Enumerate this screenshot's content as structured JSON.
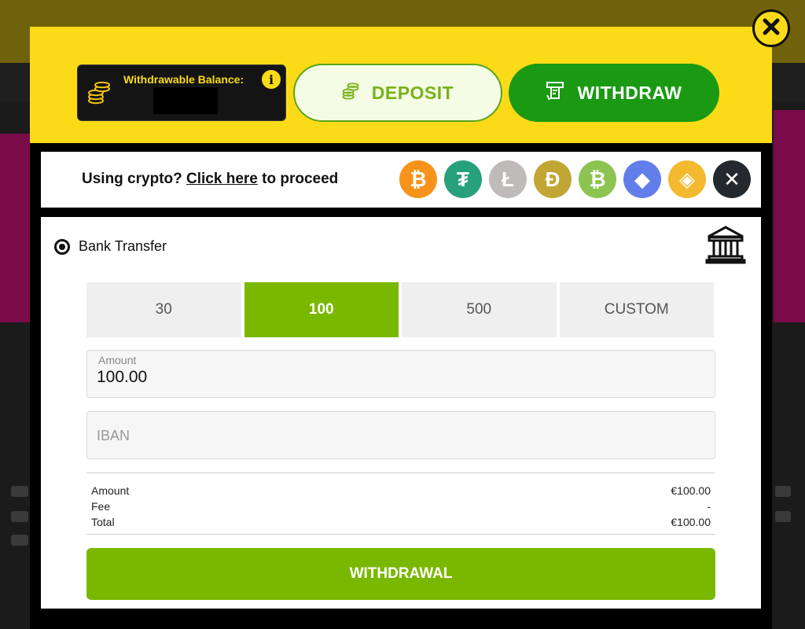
{
  "header": {
    "balance_label": "Withdrawable Balance:",
    "info_glyph": "i",
    "tabs": {
      "deposit": "DEPOSIT",
      "withdraw": "WITHDRAW"
    },
    "active_tab": "withdraw"
  },
  "crypto": {
    "prompt_prefix": "Using crypto? ",
    "link_text": "Click here",
    "prompt_suffix": " to proceed",
    "coins": [
      {
        "name": "bitcoin-icon",
        "glyph": "₿",
        "color": "#f7931a"
      },
      {
        "name": "tether-icon",
        "glyph": "₮",
        "color": "#26a17b"
      },
      {
        "name": "litecoin-icon",
        "glyph": "Ł",
        "color": "#bfbbbb"
      },
      {
        "name": "dogecoin-icon",
        "glyph": "Ð",
        "color": "#c2a633"
      },
      {
        "name": "bitcoin-cash-icon",
        "glyph": "₿",
        "color": "#8dc351"
      },
      {
        "name": "ethereum-icon",
        "glyph": "◆",
        "color": "#627eea"
      },
      {
        "name": "binance-icon",
        "glyph": "◈",
        "color": "#f3ba2f"
      },
      {
        "name": "ripple-icon",
        "glyph": "✕",
        "color": "#23292f"
      }
    ]
  },
  "method": {
    "label": "Bank Transfer",
    "selected": true
  },
  "amount_options": [
    "30",
    "100",
    "500",
    "CUSTOM"
  ],
  "selected_amount_index": 1,
  "form": {
    "amount_label": "Amount",
    "amount_value": "100.00",
    "iban_placeholder": "IBAN"
  },
  "summary": {
    "rows": [
      {
        "label": "Amount",
        "value": "€100.00"
      },
      {
        "label": "Fee",
        "value": "-"
      },
      {
        "label": "Total",
        "value": "€100.00"
      }
    ]
  },
  "submit_label": "WITHDRAWAL",
  "colors": {
    "header_yellow": "#fbdb17",
    "accent_green": "#7ab800",
    "withdraw_green": "#1a9a12"
  }
}
